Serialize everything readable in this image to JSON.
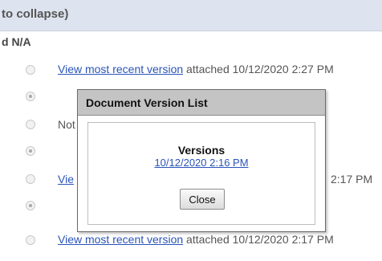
{
  "header": {
    "text": "to collapse)"
  },
  "columns": {
    "header": "d  N/A"
  },
  "rows": [
    {
      "link": "View most recent version",
      "rest": " attached 10/12/2020 2:27 PM"
    },
    {
      "text": "Not"
    },
    {
      "link": "Vie",
      "time": "2:17 PM"
    },
    {
      "link": "View most recent version",
      "rest": " attached 10/12/2020 2:17 PM"
    }
  ],
  "dialog": {
    "title": "Document Version List",
    "versions_heading": "Versions",
    "version_link": "10/12/2020 2:16 PM",
    "close_label": "Close"
  },
  "colors": {
    "link": "#2a54b8",
    "header_bg": "#dde3ef",
    "titlebar_bg": "#c4c4c4"
  }
}
